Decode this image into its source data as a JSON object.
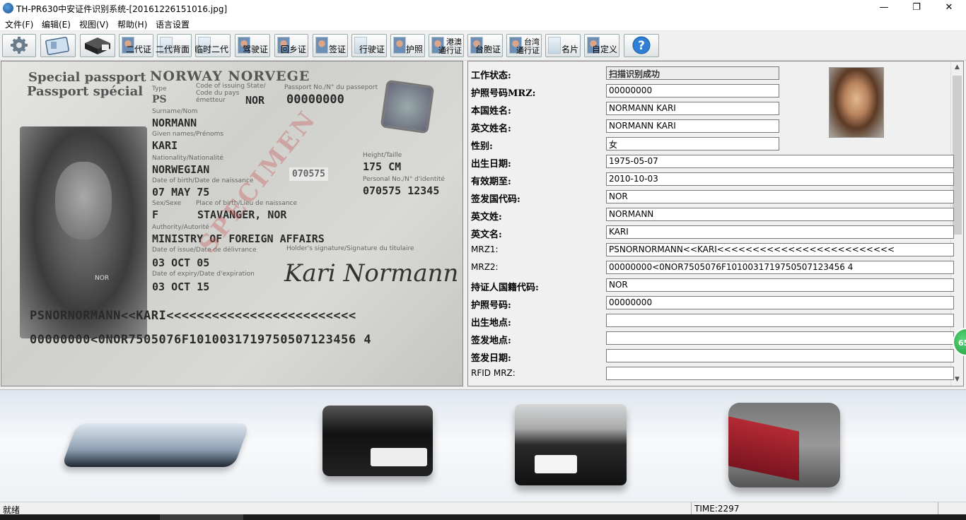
{
  "window": {
    "title": "TH-PR630中安证件识别系统-[20161226151016.jpg]",
    "minimize_icon": "minimize-icon",
    "maximize_icon": "restore-icon",
    "close_icon": "close-icon"
  },
  "menu": [
    "文件(F)",
    "编辑(E)",
    "视图(V)",
    "帮助(H)",
    "语言设置"
  ],
  "toolbar": {
    "icon_buttons": [
      "settings-gear-icon",
      "scan-card-icon",
      "scanner-device-icon"
    ],
    "doc_buttons": [
      {
        "label": "二代证"
      },
      {
        "label": "二代背面"
      },
      {
        "label": "临时二代"
      },
      {
        "label": "驾驶证"
      },
      {
        "label": "回乡证"
      },
      {
        "label": "签证"
      },
      {
        "label": "行驶证"
      },
      {
        "label": "护照"
      },
      {
        "label_top": "港澳",
        "label_bottom": "通行证"
      },
      {
        "label": "台胞证"
      },
      {
        "label_top": "台湾",
        "label_bottom": "通行证"
      },
      {
        "label": "名片"
      },
      {
        "label": "自定义"
      }
    ],
    "help_icon": "help-question-icon"
  },
  "passport_image": {
    "heading1": "Special passport",
    "heading2": "Passport spécial",
    "country": "NORWAY  NORVEGE",
    "type_label": "Type",
    "type": "PS",
    "issuing_state_label": "Code of issuing State/",
    "issuing_state_label2": "Code du pays",
    "issuing_state_label3": "émetteur",
    "issuing_state": "NOR",
    "passport_no_label": "Passport No./N° du passeport",
    "passport_no": "00000000",
    "surname_label": "Surname/Nom",
    "surname": "NORMANN",
    "given_label": "Given names/Prénoms",
    "given": "KARI",
    "nationality_label": "Nationality/Nationalité",
    "nationality": "NORWEGIAN",
    "number_stamp": "070575",
    "height_label": "Height/Taille",
    "height": "175 CM",
    "dob_label": "Date of birth/Date de naissance",
    "dob": "07 MAY 75",
    "personal_no_label": "Personal No./N° d'identité",
    "personal_no": "070575 12345",
    "sex_label": "Sex/Sexe",
    "sex": "F",
    "pob_label": "Place of birth/Lieu de naissance",
    "pob": "STAVANGER, NOR",
    "authority_label": "Authority/Autorité",
    "authority": "MINISTRY OF FOREIGN AFFAIRS",
    "issue_label": "Date of issue/Date de délivrance",
    "issue": "03 OCT 05",
    "signature_label": "Holder's signature/Signature du titulaire",
    "expiry_label": "Date of expiry/Date d'expiration",
    "expiry": "03 OCT 15",
    "specimen": "SPECIMEN",
    "signature": "Kari Normann",
    "photo_caption": "NOR",
    "mrz1": "PSNORNORMANN<<KARI<<<<<<<<<<<<<<<<<<<<<<<<<",
    "mrz2": "00000000<0NOR7505076F1010031719750507123456 4"
  },
  "fields": [
    {
      "label": "工作状态:",
      "value": "扫描识别成功"
    },
    {
      "label": "护照号码MRZ:",
      "value": "00000000"
    },
    {
      "label": "本国姓名:",
      "value": "NORMANN  KARI"
    },
    {
      "label": "英文姓名:",
      "value": "NORMANN  KARI"
    },
    {
      "label": "性别:",
      "value": "女"
    },
    {
      "label": "出生日期:",
      "value": "1975-05-07"
    },
    {
      "label": "有效期至:",
      "value": "2010-10-03"
    },
    {
      "label": "签发国代码:",
      "value": "NOR"
    },
    {
      "label": "英文姓:",
      "value": "NORMANN"
    },
    {
      "label": "英文名:",
      "value": "KARI"
    },
    {
      "label": "MRZ1:",
      "value": "PSNORNORMANN<<KARI<<<<<<<<<<<<<<<<<<<<<<<<<"
    },
    {
      "label": "MRZ2:",
      "value": "00000000<0NOR7505076F1010031719750507123456 4"
    },
    {
      "label": "持证人国籍代码:",
      "value": "NOR"
    },
    {
      "label": "护照号码:",
      "value": "00000000"
    },
    {
      "label": "出生地点:",
      "value": ""
    },
    {
      "label": "签发地点:",
      "value": ""
    },
    {
      "label": "签发日期:",
      "value": ""
    },
    {
      "label": "RFID MRZ:",
      "value": ""
    }
  ],
  "badge": "65",
  "status": {
    "left": "就绪",
    "time": "TIME:2297"
  }
}
